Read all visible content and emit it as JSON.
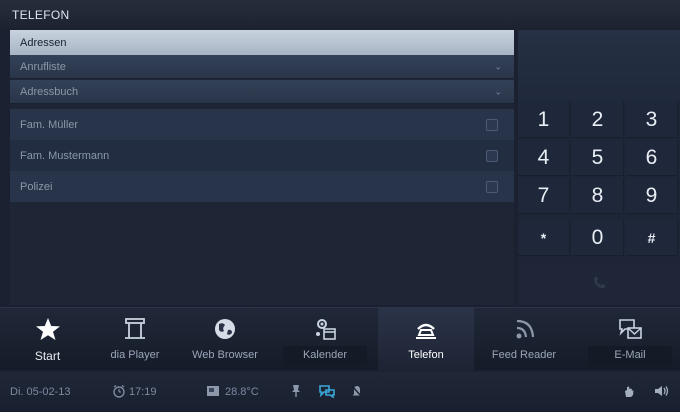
{
  "app": {
    "title": "TELEFON"
  },
  "contacts_panel": {
    "header": "Adressen",
    "dropdowns": [
      {
        "label": "Anrufliste"
      },
      {
        "label": "Adressbuch"
      }
    ],
    "entries": [
      {
        "name": "Fam. Müller",
        "checked": false
      },
      {
        "name": "Fam. Mustermann",
        "checked": false
      },
      {
        "name": "Polizei",
        "checked": false
      }
    ]
  },
  "dialpad": {
    "keys": [
      "1",
      "2",
      "3",
      "4",
      "5",
      "6",
      "7",
      "8",
      "9",
      "*",
      "0",
      "#"
    ]
  },
  "dock": {
    "items": [
      {
        "label": "Start",
        "icon": "star-icon"
      },
      {
        "label": "dia Player",
        "icon": "media-player-icon"
      },
      {
        "label": "Web Browser",
        "icon": "globe-icon"
      },
      {
        "label": "Kalender",
        "icon": "calendar-gear-icon"
      },
      {
        "label": "Telefon",
        "icon": "phone-icon",
        "active": true
      },
      {
        "label": "Feed Reader",
        "icon": "rss-icon"
      },
      {
        "label": "E-Mail",
        "icon": "mail-chat-icon"
      }
    ]
  },
  "status": {
    "date": "Di. 05-02-13",
    "time": "17:19",
    "temperature": "28.8°C",
    "accent_color": "#3aa6d8"
  }
}
